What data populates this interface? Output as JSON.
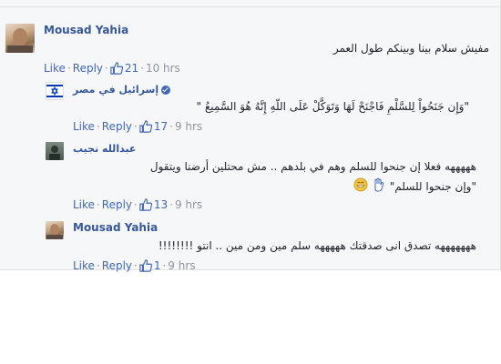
{
  "comments": [
    {
      "author": "Mousad Yahia",
      "text": "مفيش سلام بينا وبينكم طول العمر",
      "like_label": "Like",
      "reply_label": "Reply",
      "likes": "21",
      "time": "10 hrs"
    },
    {
      "author": "إسرائيل في مصر",
      "text": "\"وَإِن جَنَحُواْ لِلسَّلْمِ فَاجْنَحْ لَهَا وَتَوَكَّلْ عَلَى اللّهِ إِنَّهُ هُوَ السَّمِيعُ \"",
      "like_label": "Like",
      "reply_label": "Reply",
      "likes": "17",
      "time": "9 hrs"
    },
    {
      "author": "عبدالله نجيب",
      "text_line1": "هههههه فعلا إن جنحوا للسلم وهم في بلدهم .. مش محتلين أرضنا ويتقول",
      "text_line2": "\"وإن جنحوا للسلم\"",
      "like_label": "Like",
      "reply_label": "Reply",
      "likes": "13",
      "time": "9 hrs"
    },
    {
      "author": "Mousad Yahia",
      "text": "هههههههه تصدق انى صدقتك هههههه سلم مين ومن مين .. انتو !!!!!!!!",
      "like_label": "Like",
      "reply_label": "Reply",
      "likes": "1",
      "time": "9 hrs"
    }
  ],
  "separator": "·",
  "colors": {
    "link": "#4267b2",
    "name": "#365899",
    "muted": "#90949c",
    "panel": "#f6f7f9"
  },
  "icons": {
    "like": "thumbs-up-icon",
    "verified": "verified-badge-icon",
    "emoji": "grinning-emoji-icon"
  }
}
